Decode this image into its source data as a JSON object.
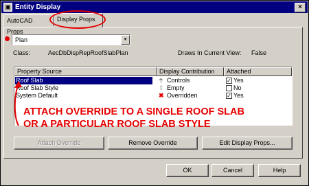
{
  "window": {
    "title": "Entity Display",
    "close_glyph": "×"
  },
  "tabs": [
    {
      "label": "AutoCAD Props"
    },
    {
      "label": "Display Props"
    }
  ],
  "display_rep": {
    "selected": "Plan"
  },
  "info": {
    "class_label": "Class:",
    "class_value": "AecDbDispRepRoofSlabPlan",
    "draws_label": "Draws In Current View:",
    "draws_value": "False"
  },
  "table": {
    "columns": [
      "Property Source",
      "Display Contribution",
      "Attached"
    ],
    "rows": [
      {
        "source": "Roof Slab",
        "contribution": "Controls",
        "attached": "Yes",
        "checked": true,
        "selected": true
      },
      {
        "source": "Roof Slab Style",
        "contribution": "Empty",
        "attached": "No",
        "checked": false,
        "selected": false
      },
      {
        "source": "System Default",
        "contribution": "Overridden",
        "attached": "Yes",
        "checked": true,
        "selected": false
      }
    ]
  },
  "annotation": {
    "line1": "ATTACH OVERRIDE TO A SINGLE ROOF SLAB",
    "line2": "OR A PARTICULAR ROOF SLAB STYLE",
    "color": "#e60000"
  },
  "actions": {
    "attach_override": "Attach Override",
    "remove_override": "Remove Override",
    "edit_display_props": "Edit Display Props..."
  },
  "footer": {
    "ok": "OK",
    "cancel": "Cancel",
    "help": "Help"
  }
}
